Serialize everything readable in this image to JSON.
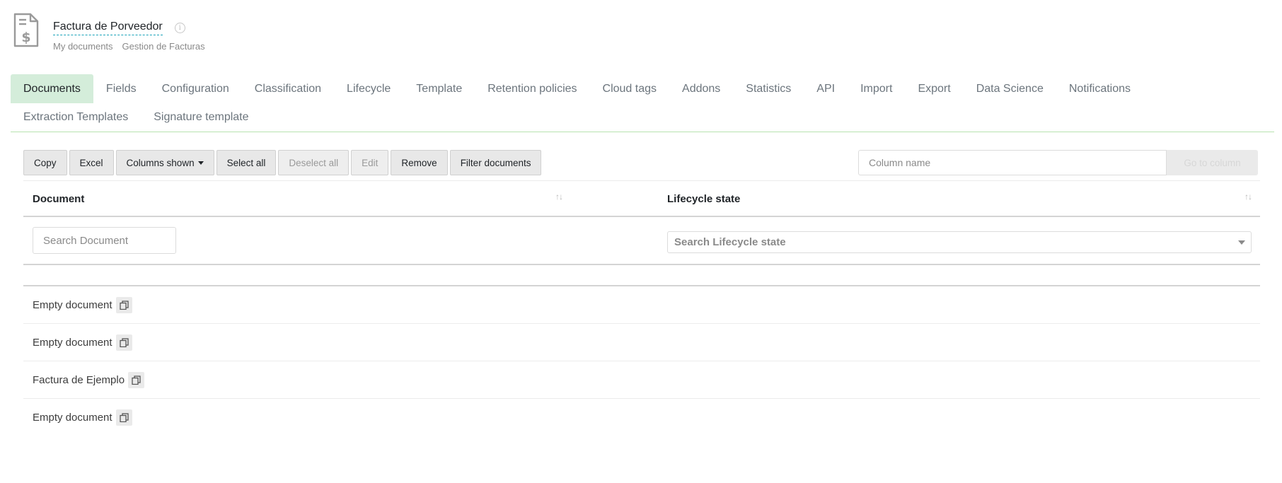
{
  "header": {
    "title": "Factura de Porveedor",
    "breadcrumb": [
      "My documents",
      "Gestion de Facturas"
    ]
  },
  "tabs": {
    "row1": [
      "Documents",
      "Fields",
      "Configuration",
      "Classification",
      "Lifecycle",
      "Template",
      "Retention policies",
      "Cloud tags",
      "Addons",
      "Statistics",
      "API",
      "Import",
      "Export",
      "Data Science",
      "Notifications"
    ],
    "row2": [
      "Extraction Templates",
      "Signature template"
    ],
    "active": "Documents"
  },
  "toolbar": {
    "copy": "Copy",
    "excel": "Excel",
    "columns_shown": "Columns shown",
    "select_all": "Select all",
    "deselect_all": "Deselect all",
    "edit": "Edit",
    "remove": "Remove",
    "filter": "Filter documents"
  },
  "column_search": {
    "placeholder": "Column name",
    "button": "Go to column"
  },
  "table": {
    "columns": [
      "Document",
      "Lifecycle state"
    ],
    "search_document_placeholder": "Search Document",
    "search_lifecycle_placeholder": "Search Lifecycle state",
    "rows": [
      {
        "document": "Empty document",
        "lifecycle": ""
      },
      {
        "document": "Empty document",
        "lifecycle": ""
      },
      {
        "document": "Factura de Ejemplo",
        "lifecycle": ""
      },
      {
        "document": "Empty document",
        "lifecycle": ""
      }
    ]
  },
  "colors": {
    "active_tab_bg": "#d4edda",
    "tab_border": "#b8e3b0",
    "title_underline": "#17a2b8"
  }
}
